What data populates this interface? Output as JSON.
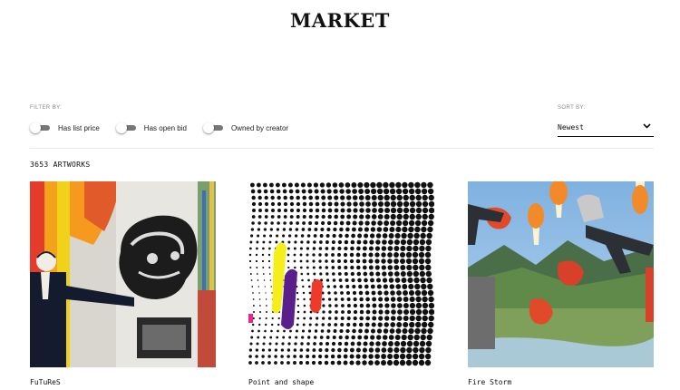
{
  "header": {
    "title": "MARKET"
  },
  "filters": {
    "label": "FILTER BY:",
    "items": [
      {
        "label": "Has list price",
        "on": false
      },
      {
        "label": "Has open bid",
        "on": false
      },
      {
        "label": "Owned by creator",
        "on": false
      }
    ]
  },
  "sort": {
    "label": "SORT BY:",
    "value": "Newest"
  },
  "results": {
    "count_text": "3653 ARTWORKS"
  },
  "artworks": [
    {
      "title": "FuTuReS"
    },
    {
      "title": "Point and shape"
    },
    {
      "title": "Fire Storm"
    }
  ]
}
